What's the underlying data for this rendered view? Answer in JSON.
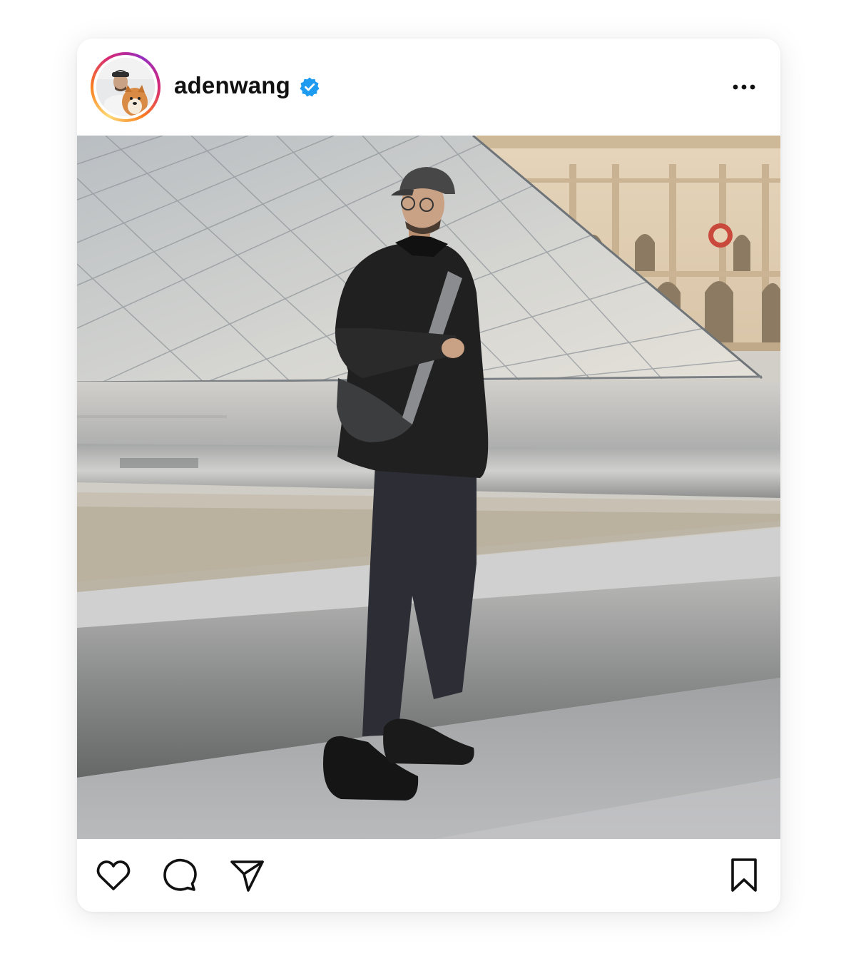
{
  "post": {
    "username": "adenwang",
    "verified": true
  },
  "icons": {
    "verified": "verified-badge-icon",
    "more": "more-options-icon",
    "like": "heart-icon",
    "comment": "comment-icon",
    "share": "paper-plane-icon",
    "save": "bookmark-icon"
  },
  "colors": {
    "verified_blue": "#1d9bf0",
    "text": "#111111"
  }
}
